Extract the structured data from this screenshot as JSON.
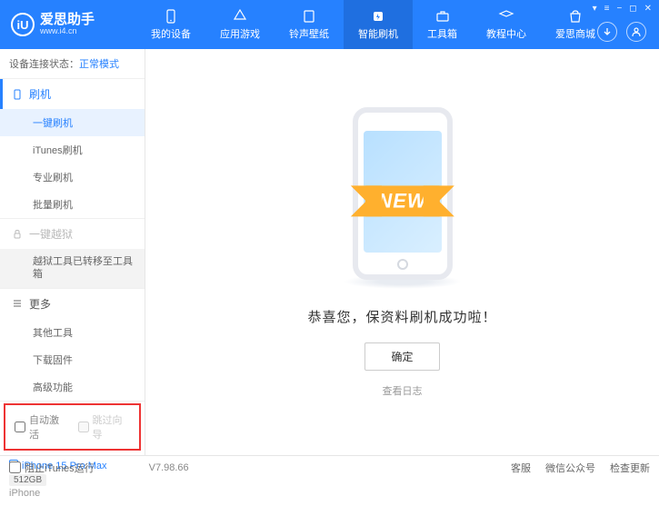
{
  "app": {
    "name": "爱思助手",
    "url": "www.i4.cn",
    "logo_letter": "iU"
  },
  "top_nav": [
    {
      "label": "我的设备"
    },
    {
      "label": "应用游戏"
    },
    {
      "label": "铃声壁纸"
    },
    {
      "label": "智能刷机"
    },
    {
      "label": "工具箱"
    },
    {
      "label": "教程中心"
    },
    {
      "label": "爱思商城"
    }
  ],
  "status": {
    "prefix": "设备连接状态：",
    "mode": "正常模式"
  },
  "sidebar": {
    "flash_group": "刷机",
    "items_flash": [
      "一键刷机",
      "iTunes刷机",
      "专业刷机",
      "批量刷机"
    ],
    "jb_group": "一键越狱",
    "jb_note": "越狱工具已转移至工具箱",
    "more_group": "更多",
    "items_more": [
      "其他工具",
      "下载固件",
      "高级功能"
    ],
    "checkboxes": {
      "auto_activate": "自动激活",
      "skip_guide": "跳过向导"
    },
    "device": {
      "name": "iPhone 15 Pro Max",
      "storage": "512GB",
      "type": "iPhone"
    }
  },
  "main": {
    "new_badge": "NEW",
    "success": "恭喜您，保资料刷机成功啦！",
    "ok": "确定",
    "log": "查看日志"
  },
  "footer": {
    "block_itunes": "阻止iTunes运行",
    "version": "V7.98.66",
    "links": [
      "客服",
      "微信公众号",
      "检查更新"
    ]
  }
}
